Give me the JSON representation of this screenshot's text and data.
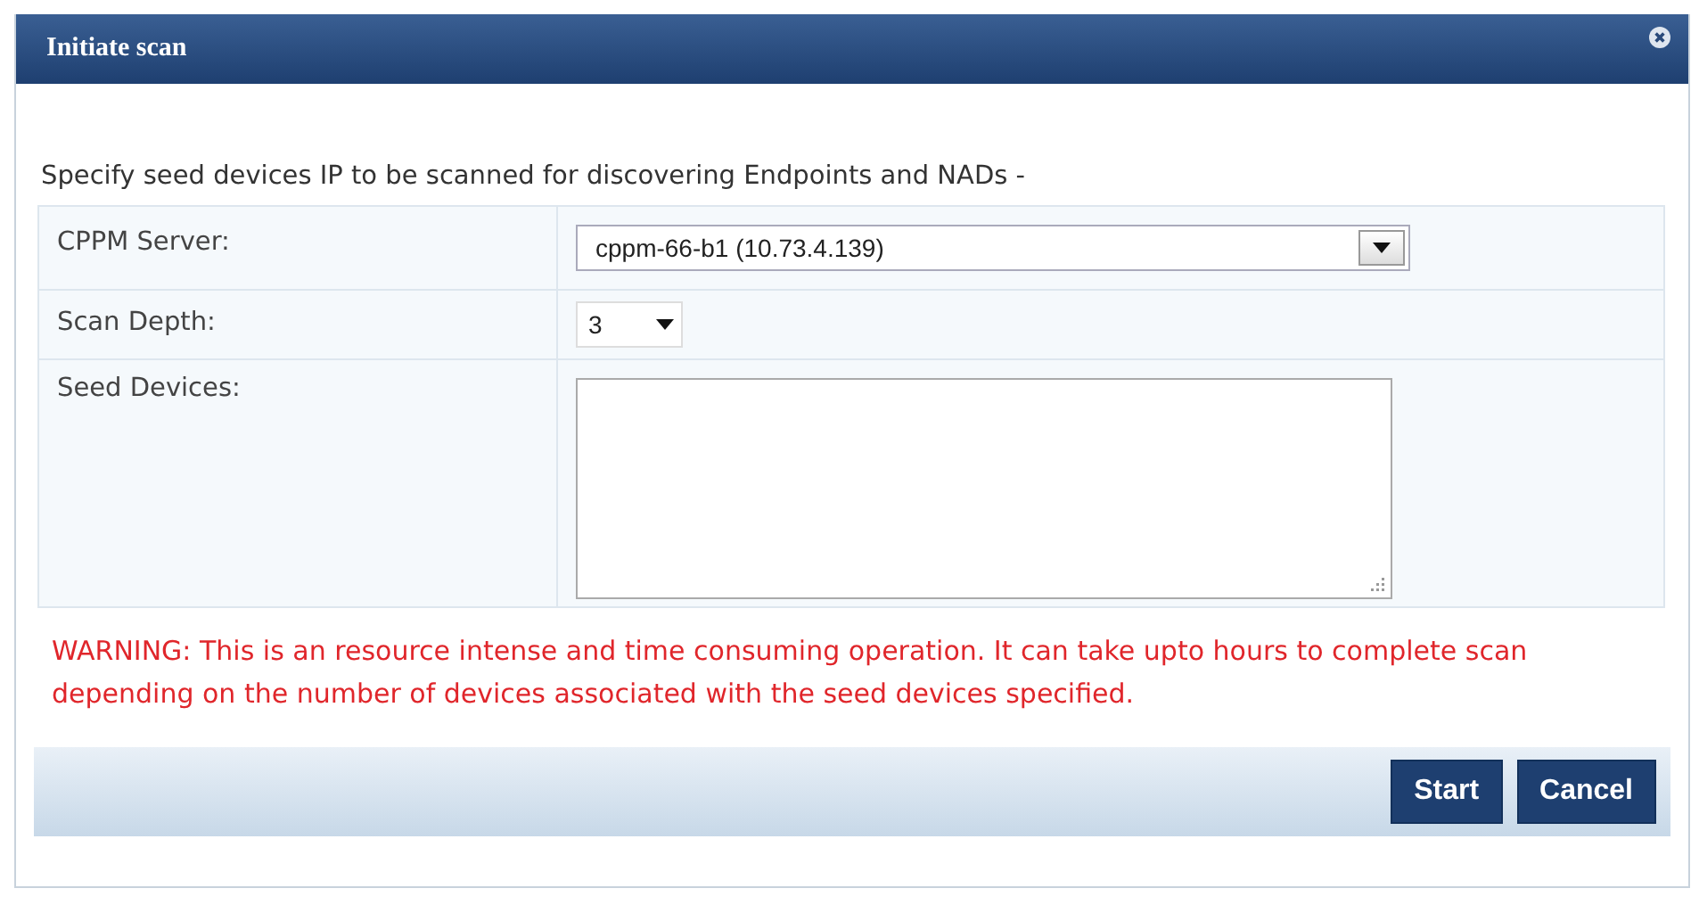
{
  "dialog": {
    "title": "Initiate scan",
    "intro": "Specify seed devices IP to be scanned for discovering Endpoints and NADs -",
    "fields": [
      {
        "kind": "select",
        "label": "CPPM Server:",
        "value": "cppm-66-b1 (10.73.4.139)"
      },
      {
        "kind": "small-select",
        "label": "Scan Depth:",
        "value": "3"
      },
      {
        "kind": "textarea",
        "label": "Seed Devices:"
      }
    ],
    "warning": "WARNING: This is an resource intense and time consuming operation. It can take upto hours to complete scan depending on the number of devices associated with the seed devices specified.",
    "buttons": [
      "Start",
      "Cancel"
    ]
  }
}
